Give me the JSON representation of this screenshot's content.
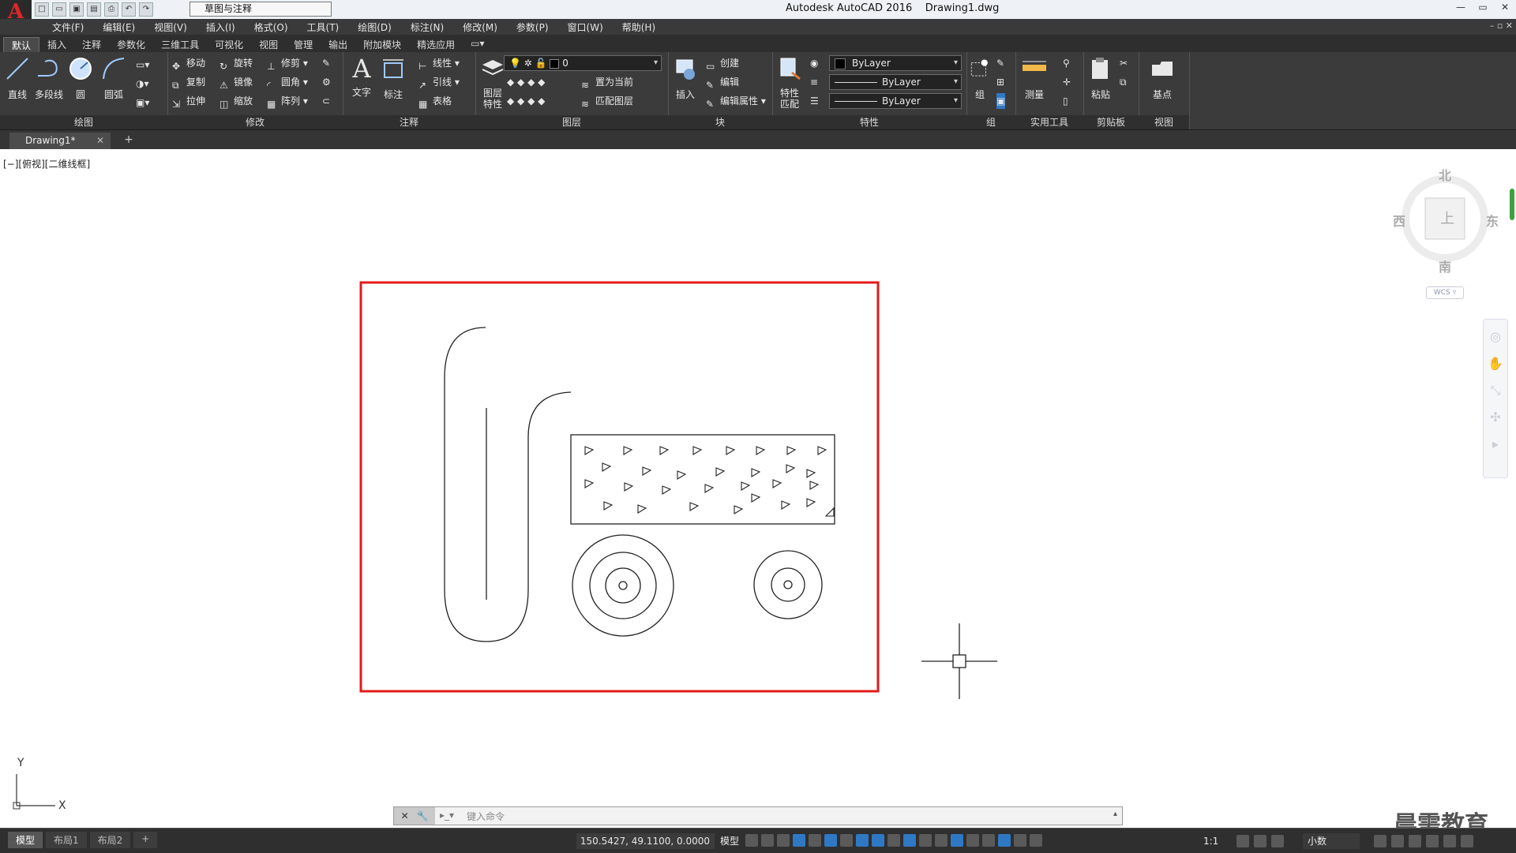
{
  "title_bar": {
    "app_title": "Autodesk AutoCAD 2016    Drawing1.dwg",
    "workspace": "草图与注释",
    "window_buttons": [
      "—",
      "▭",
      "✕"
    ]
  },
  "menu": [
    "文件(F)",
    "编辑(E)",
    "视图(V)",
    "插入(I)",
    "格式(O)",
    "工具(T)",
    "绘图(D)",
    "标注(N)",
    "修改(M)",
    "参数(P)",
    "窗口(W)",
    "帮助(H)"
  ],
  "mdi_buttons": "– ▫ ✕",
  "ribbon_tabs": [
    "默认",
    "插入",
    "注释",
    "参数化",
    "三维工具",
    "可视化",
    "视图",
    "管理",
    "输出",
    "附加模块",
    "精选应用"
  ],
  "ribbon": {
    "draw": {
      "title": "绘图",
      "buttons": [
        "直线",
        "多段线",
        "圆",
        "圆弧"
      ]
    },
    "modify": {
      "title": "修改",
      "buttons": [
        "移动",
        "旋转",
        "修剪",
        "复制",
        "镜像",
        "圆角",
        "拉伸",
        "缩放",
        "阵列"
      ]
    },
    "annotation": {
      "title": "注释",
      "buttons": [
        "文字",
        "标注",
        "线性",
        "引线",
        "表格"
      ]
    },
    "layers": {
      "title": "图层",
      "props_button": "图层\n特性",
      "layer_value": "0",
      "make_current": "置为当前",
      "match_layer": "匹配图层"
    },
    "block": {
      "title": "块",
      "insert": "插入",
      "create": "创建",
      "edit": "编辑",
      "edit_attr": "编辑属性"
    },
    "properties": {
      "title": "特性",
      "match": "特性\n匹配",
      "color": "ByLayer",
      "linetype": "ByLayer",
      "lineweight": "ByLayer"
    },
    "groups": {
      "title": "组",
      "group": "组"
    },
    "utilities": {
      "title": "实用工具",
      "measure": "测量"
    },
    "clipboard": {
      "title": "剪贴板",
      "paste": "粘贴"
    },
    "view": {
      "title": "视图",
      "base": "基点"
    }
  },
  "document_tab": {
    "name": "Drawing1*",
    "close": "✕",
    "new": "+"
  },
  "viewport": {
    "label": "[−][俯视][二维线框]",
    "compass": {
      "north": "北",
      "south": "南",
      "east": "东",
      "west": "西"
    },
    "ucs_label": "WCS",
    "ucs_x": "X",
    "ucs_y": "Y"
  },
  "command_line": {
    "placeholder": "键入命令"
  },
  "watermark": "晨需教育",
  "status_bar": {
    "layouts": [
      "模型",
      "布局1",
      "布局2"
    ],
    "coordinates": "150.5427, 49.1100, 0.0000",
    "model": "模型",
    "scale": "1:1",
    "units": "小数"
  },
  "colors": {
    "highlight_rect": "#e41b1b",
    "accent_blue": "#2f78c4",
    "ribbon_bg": "#3b3b3b"
  }
}
